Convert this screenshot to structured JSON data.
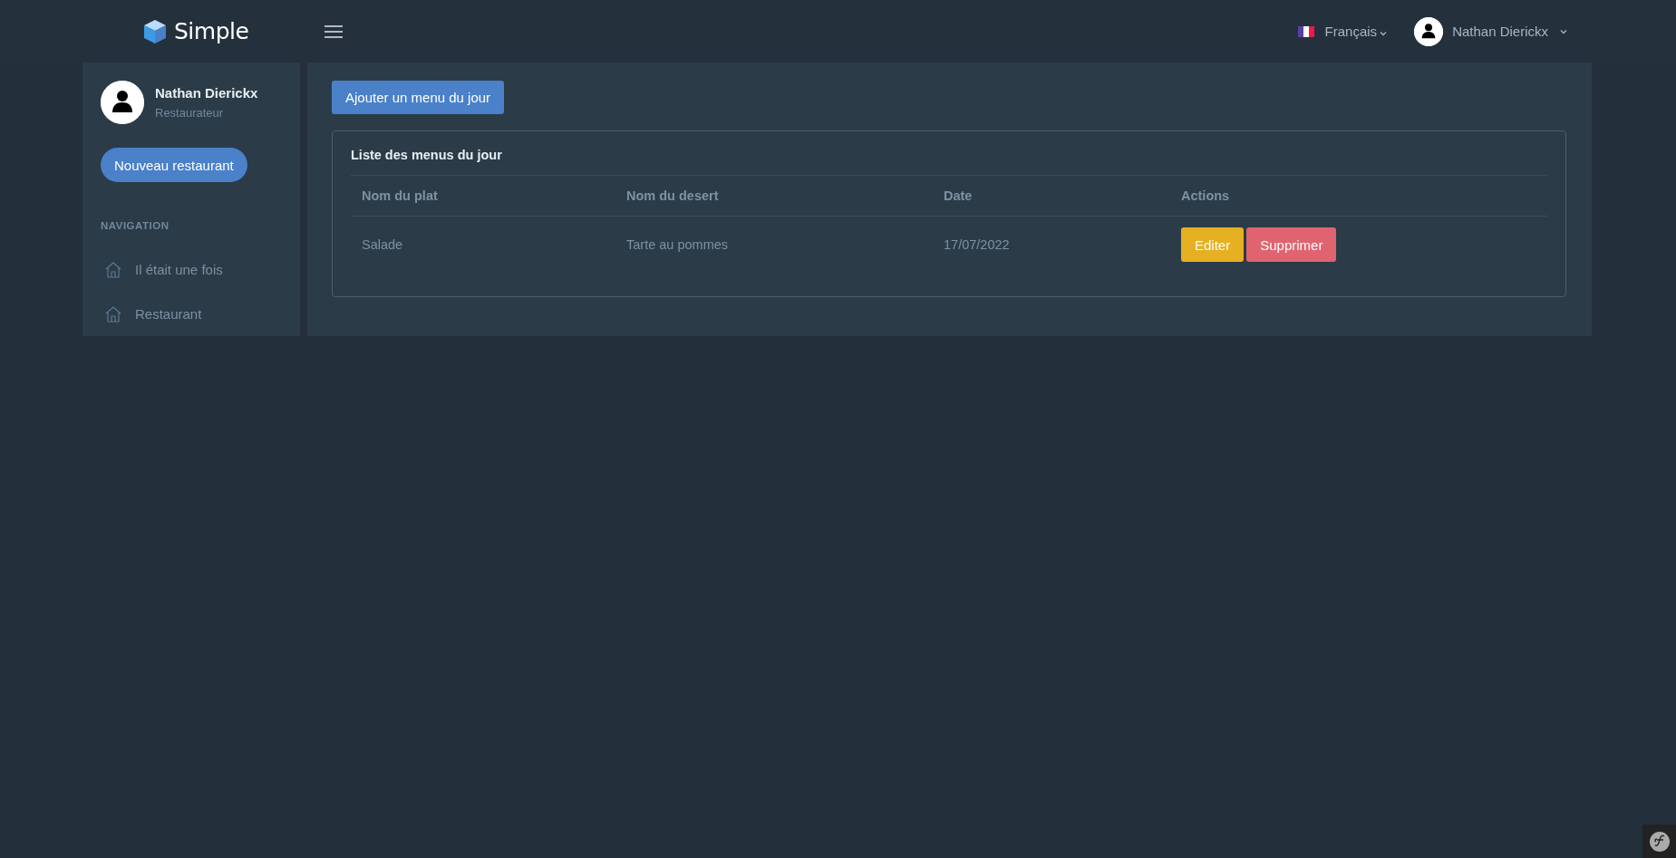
{
  "brand": {
    "name": "Simple"
  },
  "topbar": {
    "language": "Français",
    "user": "Nathan Dierickx"
  },
  "sidebar": {
    "profile": {
      "name": "Nathan Dierickx",
      "role": "Restaurateur"
    },
    "action": "Nouveau restaurant",
    "section": "NAVIGATION",
    "items": [
      {
        "label": "Il était une fois",
        "selected": false
      },
      {
        "label": "Restaurant",
        "selected": false
      }
    ]
  },
  "main": {
    "add_button": "Ajouter un menu du jour",
    "card": {
      "title": "Liste des menus du jour",
      "table": {
        "columns": [
          "Nom du plat",
          "Nom du desert",
          "Date",
          "Actions"
        ],
        "rows": [
          {
            "cells": [
              "Salade",
              "Tarte au pommes",
              "17/07/2022"
            ],
            "actions": [
              {
                "label": "Editer",
                "kind": "edit"
              },
              {
                "label": "Supprimer",
                "kind": "delete"
              }
            ]
          }
        ]
      }
    }
  }
}
